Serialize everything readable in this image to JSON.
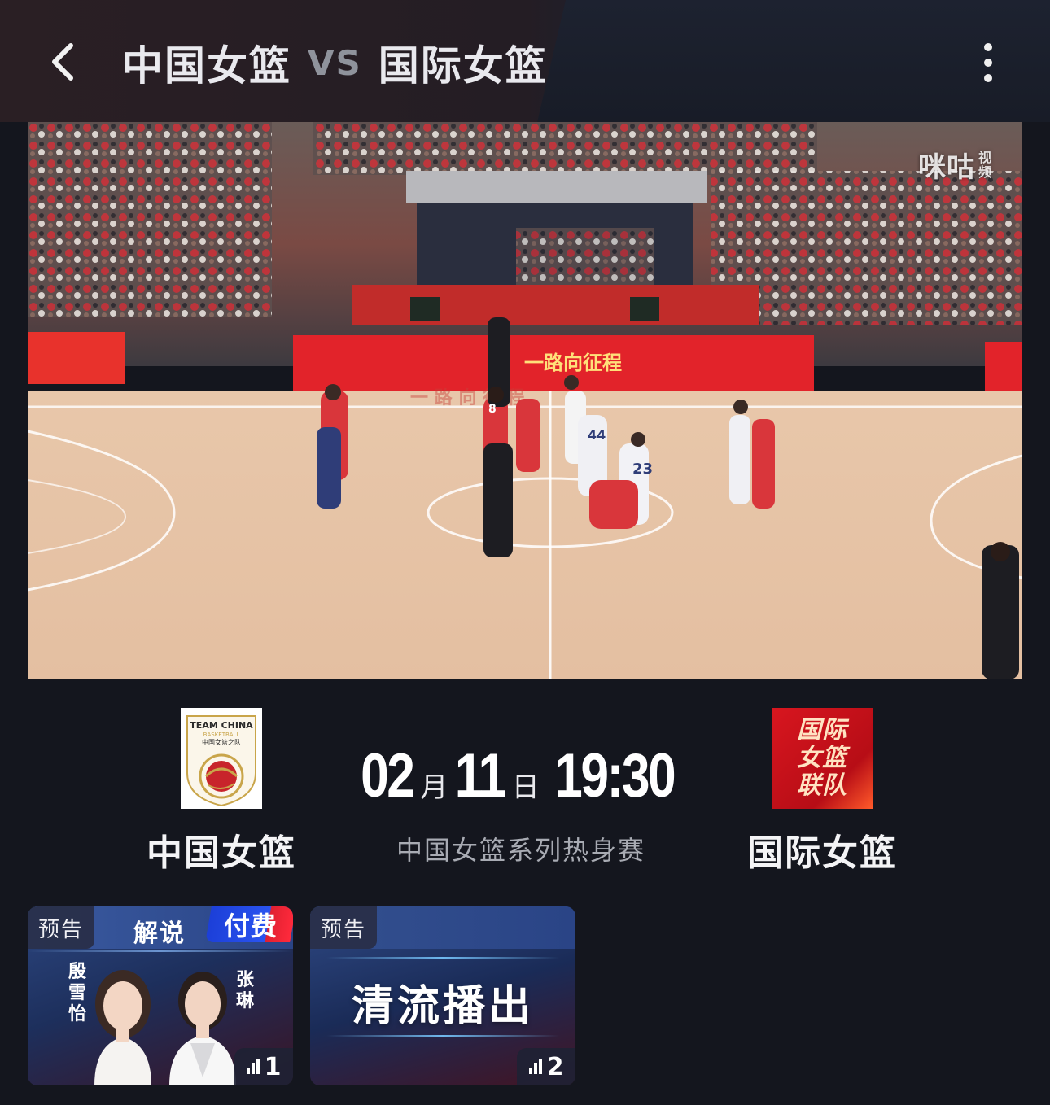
{
  "header": {
    "home_team": "中国女篮",
    "vs": "VS",
    "away_team": "国际女篮"
  },
  "video": {
    "watermark_main": "咪咕",
    "watermark_sub": "视频",
    "banner_text": "一路向征程"
  },
  "match": {
    "home": {
      "name": "中国女篮",
      "logo_text_1": "TEAM CHINA",
      "logo_text_2": "BASKETBALL",
      "logo_text_3": "中国女篮之队"
    },
    "away": {
      "name": "国际女篮",
      "logo_lines": [
        "国际",
        "女篮",
        "联队"
      ]
    },
    "month": "02",
    "month_unit": "月",
    "day": "11",
    "day_unit": "日",
    "time": "19:30",
    "competition": "中国女篮系列热身赛"
  },
  "streams": [
    {
      "tag": "预告",
      "label": "解说",
      "paid_label": "付费",
      "commentator_1": "殷雪怡",
      "commentator_2": "张琳",
      "viewer_count": "1"
    },
    {
      "tag": "预告",
      "title": "清流播出",
      "viewer_count": "2"
    }
  ],
  "colors": {
    "background": "#14161e",
    "home_red": "#d8161f",
    "paid_blue": "#2a54f0",
    "court": "#e6c4a8"
  }
}
